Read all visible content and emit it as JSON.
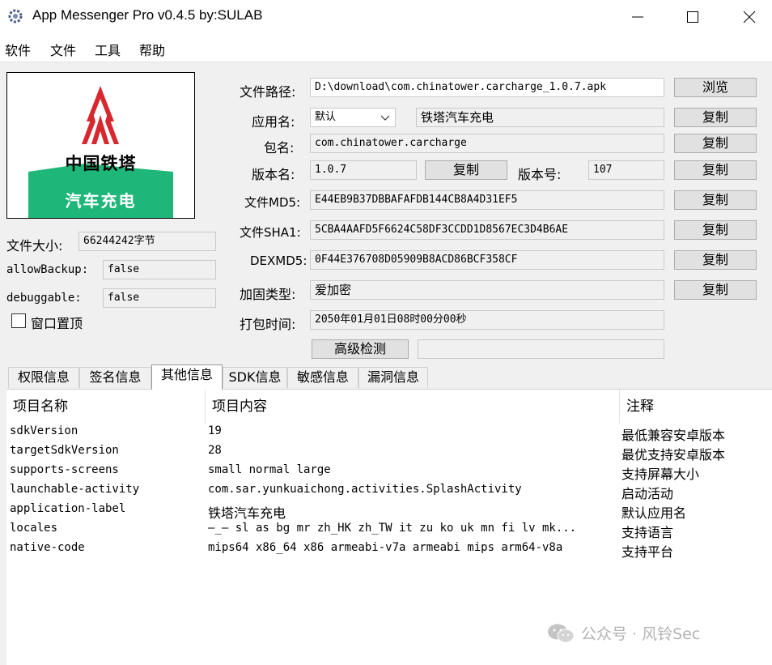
{
  "window": {
    "title": "App Messenger Pro v0.4.5   by:SULAB",
    "controls": {
      "minimize": "—",
      "maximize": "☐",
      "close": "✕"
    }
  },
  "menu": [
    "软件",
    "文件",
    "工具",
    "帮助"
  ],
  "logo": {
    "brand_text": "中国铁塔",
    "banner_text": "汽车充电",
    "brand_color": "#d7282f",
    "banner_color": "#1fb779"
  },
  "file_info": {
    "size_label": "文件大小:",
    "size_value": "66244242字节",
    "allowbackup_label": "allowBackup:",
    "allowbackup_value": "false",
    "debuggable_label": "debuggable:",
    "debuggable_value": "false",
    "pin_label": "窗口置顶"
  },
  "form": {
    "path_label": "文件路径:",
    "path_value": "D:\\download\\com.chinatower.carcharge_1.0.7.apk",
    "browse_btn": "浏览",
    "appname_label": "应用名:",
    "appname_select": "默认",
    "appname_value": "铁塔汽车充电",
    "package_label": "包名:",
    "package_value": "com.chinatower.carcharge",
    "version_name_label": "版本名:",
    "version_name_value": "1.0.7",
    "version_code_label": "版本号:",
    "version_code_value": "107",
    "md5_label": "文件MD5:",
    "md5_value": "E44EB9B37DBBAFAFDB144CB8A4D31EF5",
    "sha1_label": "文件SHA1:",
    "sha1_value": "5CBA4AAFD5F6624C58DF3CCDD1D8567EC3D4B6AE",
    "dexmd5_label": "DEXMD5:",
    "dexmd5_value": "0F44E376708D05909B8ACD86BCF358CF",
    "packer_label": "加固类型:",
    "packer_value": "爱加密",
    "packtime_label": "打包时间:",
    "packtime_value": "2050年01月01日08时00分00秒",
    "advanced_btn": "高级检测",
    "advanced_result": "",
    "copy_btn": "复制"
  },
  "tabs": [
    "权限信息",
    "签名信息",
    "其他信息",
    "SDK信息",
    "敏感信息",
    "漏洞信息"
  ],
  "active_tab": "其他信息",
  "table": {
    "headers": [
      "项目名称",
      "项目内容",
      "注释"
    ],
    "rows": [
      [
        "sdkVersion",
        "19",
        "最低兼容安卓版本"
      ],
      [
        "targetSdkVersion",
        "28",
        "最优支持安卓版本"
      ],
      [
        "supports-screens",
        "small normal large",
        "支持屏幕大小"
      ],
      [
        "launchable-activity",
        "com.sar.yunkuaichong.activities.SplashActivity",
        "启动活动"
      ],
      [
        "application-label",
        "铁塔汽车充电",
        "默认应用名"
      ],
      [
        "locales",
        "—_— sl as bg mr zh_HK zh_TW it zu ko uk mn fi lv mk...",
        "支持语言"
      ],
      [
        "native-code",
        "mips64 x86_64 x86 armeabi-v7a armeabi mips arm64-v8a",
        "支持平台"
      ]
    ]
  },
  "watermark": "公众号 · 风铃Sec"
}
